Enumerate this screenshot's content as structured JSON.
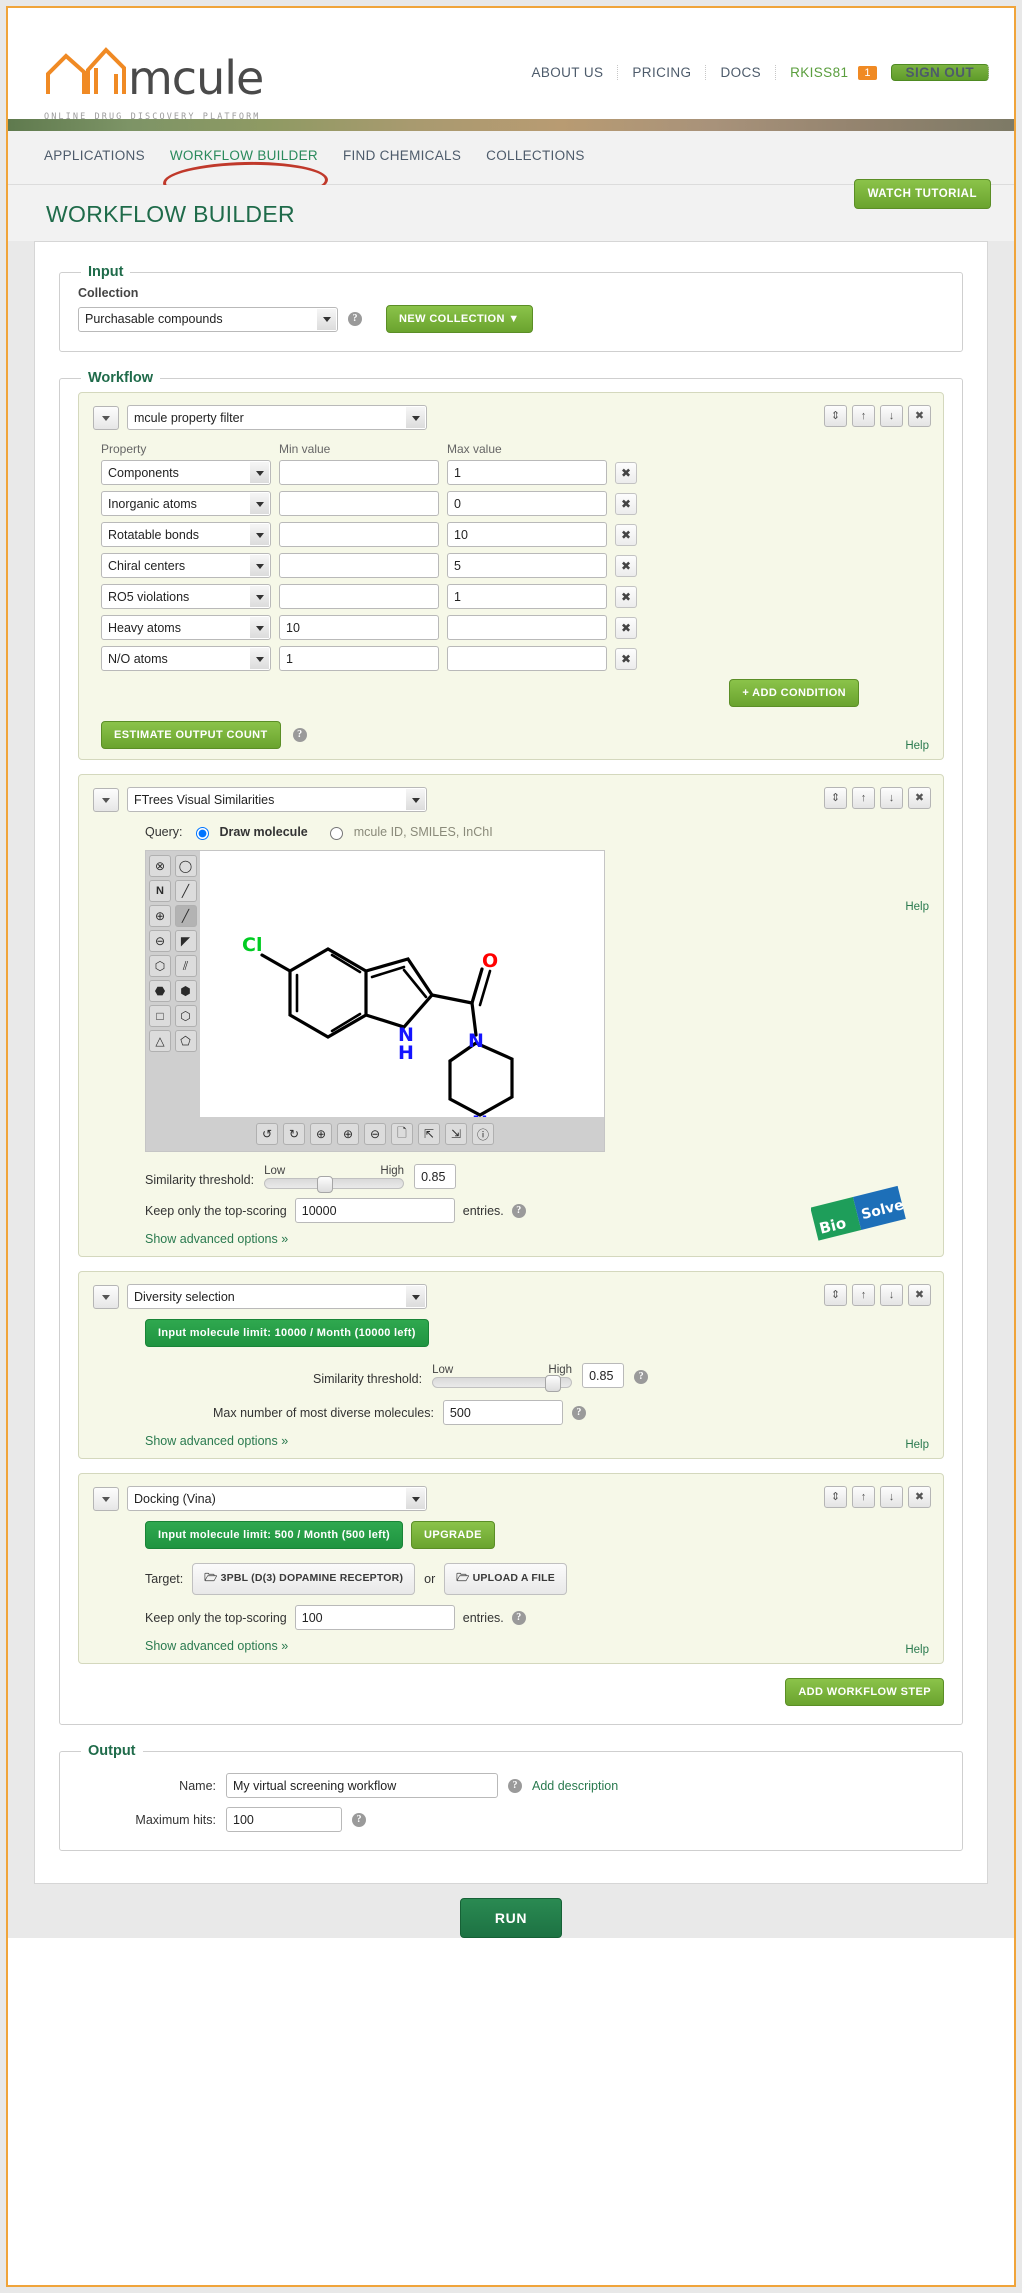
{
  "header": {
    "logo_name": "mcule",
    "logo_tagline": "ONLINE DRUG DISCOVERY PLATFORM",
    "nav": [
      {
        "label": "ABOUT US",
        "name": "nav-about-us"
      },
      {
        "label": "PRICING",
        "name": "nav-pricing"
      },
      {
        "label": "DOCS",
        "name": "nav-docs"
      }
    ],
    "username": "RKISS81",
    "notification_count": "1",
    "signout_label": "SIGN OUT"
  },
  "tabs": [
    {
      "label": "APPLICATIONS",
      "active": false
    },
    {
      "label": "WORKFLOW BUILDER",
      "active": true
    },
    {
      "label": "FIND CHEMICALS",
      "active": false
    },
    {
      "label": "COLLECTIONS",
      "active": false
    }
  ],
  "page": {
    "title": "WORKFLOW BUILDER",
    "watch_tutorial": "WATCH TUTORIAL"
  },
  "input_section": {
    "legend": "Input",
    "collection_label": "Collection",
    "collection_value": "Purchasable compounds",
    "new_collection_label": "NEW COLLECTION ▼",
    "help_icon": "?"
  },
  "workflow_section": {
    "legend": "Workflow",
    "add_step_label": "ADD WORKFLOW STEP"
  },
  "steps": [
    {
      "name": "mcule property filter",
      "help_label": "Help",
      "table_headers": {
        "property": "Property",
        "min": "Min value",
        "max": "Max value"
      },
      "conditions": [
        {
          "property": "Components",
          "min": "",
          "max": "1"
        },
        {
          "property": "Inorganic atoms",
          "min": "",
          "max": "0"
        },
        {
          "property": "Rotatable bonds",
          "min": "",
          "max": "10"
        },
        {
          "property": "Chiral centers",
          "min": "",
          "max": "5"
        },
        {
          "property": "RO5 violations",
          "min": "",
          "max": "1"
        },
        {
          "property": "Heavy atoms",
          "min": "10",
          "max": ""
        },
        {
          "property": "N/O atoms",
          "min": "1",
          "max": ""
        }
      ],
      "add_condition_label": "+ ADD CONDITION",
      "estimate_label": "ESTIMATE OUTPUT COUNT"
    },
    {
      "name": "FTrees Visual Similarities",
      "help_label": "Help",
      "query_label": "Query:",
      "query_option_draw": "Draw molecule",
      "query_option_id": "mcule ID, SMILES, InChI",
      "query_selected": "draw",
      "similarity_label": "Similarity threshold:",
      "slider_low": "Low",
      "slider_high": "High",
      "similarity_value": "0.85",
      "topscoring_prefix": "Keep only the top-scoring",
      "topscoring_value": "10000",
      "topscoring_suffix": "entries.",
      "advanced_label": "Show advanced options »",
      "molecule": {
        "atoms": [
          {
            "symbol": "Cl",
            "color": "#00cc22"
          },
          {
            "symbol": "N",
            "color": "#1414ff"
          },
          {
            "symbol": "H",
            "color": "#1414ff"
          },
          {
            "symbol": "O",
            "color": "#ff0000"
          },
          {
            "symbol": "N",
            "color": "#1414ff"
          },
          {
            "symbol": "N",
            "color": "#1414ff"
          }
        ],
        "tools_left": [
          "erase-icon",
          "lasso-icon",
          "atom-n-icon",
          "bond-dashed-icon",
          "charge-plus-icon",
          "bond-single-icon",
          "charge-minus-icon",
          "bond-wedge-icon",
          "ring-heptagon-icon",
          "bond-hash-icon",
          "ring-octagon-icon",
          "ring-aromatic-icon",
          "shape-square-icon",
          "ring-hexagon-icon",
          "shape-triangle-icon",
          "ring-pentagon-icon"
        ],
        "tools_bottom": [
          "undo-icon",
          "redo-icon",
          "center-icon",
          "zoom-in-icon",
          "zoom-out-icon",
          "new-file-icon",
          "import-icon",
          "export-icon",
          "info-icon"
        ]
      },
      "watermark": {
        "top": "Solve",
        "bottom": "Bio"
      }
    },
    {
      "name": "Diversity selection",
      "help_label": "Help",
      "limit_badge": "Input molecule limit: 10000 / Month (10000 left)",
      "similarity_label": "Similarity threshold:",
      "slider_low": "Low",
      "slider_high": "High",
      "similarity_value": "0.85",
      "max_diverse_label": "Max number of most diverse molecules:",
      "max_diverse_value": "500",
      "advanced_label": "Show advanced options »"
    },
    {
      "name": "Docking (Vina)",
      "help_label": "Help",
      "limit_badge": "Input molecule limit: 500 / Month (500 left)",
      "upgrade_label": "UPGRADE",
      "target_label": "Target:",
      "target_value": "3PBL (D(3) DOPAMINE RECEPTOR)",
      "or_label": "or",
      "upload_label": "UPLOAD A FILE",
      "topscoring_prefix": "Keep only the top-scoring",
      "topscoring_value": "100",
      "topscoring_suffix": "entries.",
      "advanced_label": "Show advanced options »"
    }
  ],
  "output_section": {
    "legend": "Output",
    "name_label": "Name:",
    "name_value": "My virtual screening workflow",
    "add_description_label": "Add description",
    "max_hits_label": "Maximum hits:",
    "max_hits_value": "100"
  },
  "run_button": "RUN",
  "colors": {
    "brand_green": "#1f6b4a",
    "accent_orange": "#f0a43a",
    "button_green": "#6aa32e",
    "annotation_red": "#c0392b"
  }
}
